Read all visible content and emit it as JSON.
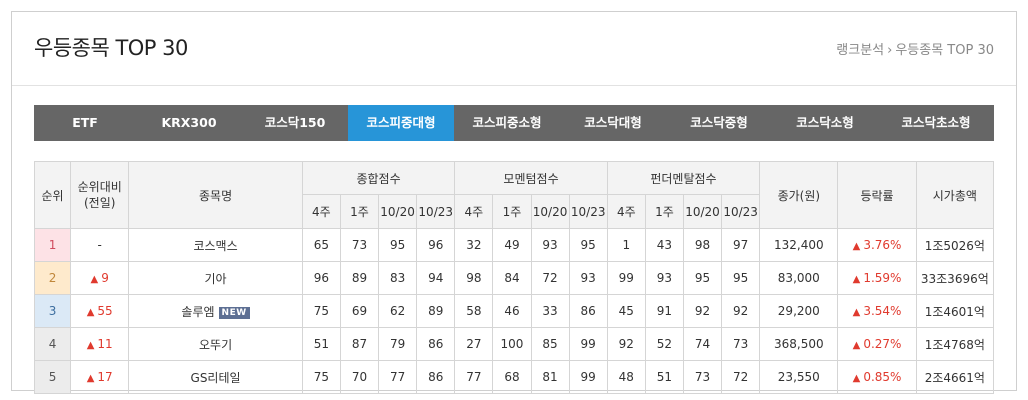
{
  "header": {
    "title": "우등종목 TOP 30",
    "breadcrumb": {
      "parent": "랭크분석",
      "separator": "›",
      "current": "우등종목 TOP 30"
    }
  },
  "tabs": [
    {
      "label": "ETF",
      "active": false
    },
    {
      "label": "KRX300",
      "active": false
    },
    {
      "label": "코스닥150",
      "active": false
    },
    {
      "label": "코스피중대형",
      "active": true
    },
    {
      "label": "코스피중소형",
      "active": false
    },
    {
      "label": "코스닥대형",
      "active": false
    },
    {
      "label": "코스닥중형",
      "active": false
    },
    {
      "label": "코스닥소형",
      "active": false
    },
    {
      "label": "코스닥초소형",
      "active": false
    }
  ],
  "table": {
    "headers": {
      "rank": "순위",
      "rank_change": "순위대비\n(전일)",
      "name": "종목명",
      "total_score": "종합점수",
      "momentum_score": "모멘텀점수",
      "fundamental_score": "펀더멘탈점수",
      "price": "종가(원)",
      "change": "등락률",
      "market_cap": "시가총액",
      "periods": [
        "4주",
        "1주",
        "10/20",
        "10/23"
      ]
    },
    "rows": [
      {
        "rank": "1",
        "change_rank": "-",
        "change_up": false,
        "name": "코스맥스",
        "badge": "",
        "total": [
          "65",
          "73",
          "95",
          "96"
        ],
        "momentum": [
          "32",
          "49",
          "93",
          "95"
        ],
        "fundamental": [
          "1",
          "43",
          "98",
          "97"
        ],
        "price": "132,400",
        "rate": "3.76%",
        "cap": "1조5026억"
      },
      {
        "rank": "2",
        "change_rank": "9",
        "change_up": true,
        "name": "기아",
        "badge": "",
        "total": [
          "96",
          "89",
          "83",
          "94"
        ],
        "momentum": [
          "98",
          "84",
          "72",
          "93"
        ],
        "fundamental": [
          "99",
          "93",
          "95",
          "95"
        ],
        "price": "83,000",
        "rate": "1.59%",
        "cap": "33조3696억"
      },
      {
        "rank": "3",
        "change_rank": "55",
        "change_up": true,
        "name": "솔루엠",
        "badge": "NEW",
        "total": [
          "75",
          "69",
          "62",
          "89"
        ],
        "momentum": [
          "58",
          "46",
          "33",
          "86"
        ],
        "fundamental": [
          "45",
          "91",
          "92",
          "92"
        ],
        "price": "29,200",
        "rate": "3.54%",
        "cap": "1조4601억"
      },
      {
        "rank": "4",
        "change_rank": "11",
        "change_up": true,
        "name": "오뚜기",
        "badge": "",
        "total": [
          "51",
          "87",
          "79",
          "86"
        ],
        "momentum": [
          "27",
          "100",
          "85",
          "99"
        ],
        "fundamental": [
          "92",
          "52",
          "74",
          "73"
        ],
        "price": "368,500",
        "rate": "0.27%",
        "cap": "1조4768억"
      },
      {
        "rank": "5",
        "change_rank": "17",
        "change_up": true,
        "name": "GS리테일",
        "badge": "",
        "total": [
          "75",
          "70",
          "77",
          "86"
        ],
        "momentum": [
          "77",
          "68",
          "81",
          "99"
        ],
        "fundamental": [
          "48",
          "51",
          "73",
          "72"
        ],
        "price": "23,550",
        "rate": "0.85%",
        "cap": "2조4661억"
      }
    ]
  },
  "colors": {
    "accent": "#2795d8",
    "tab_bar": "#666666",
    "up": "#e03a2e"
  },
  "icons": {
    "up_triangle": "up-triangle-icon"
  }
}
